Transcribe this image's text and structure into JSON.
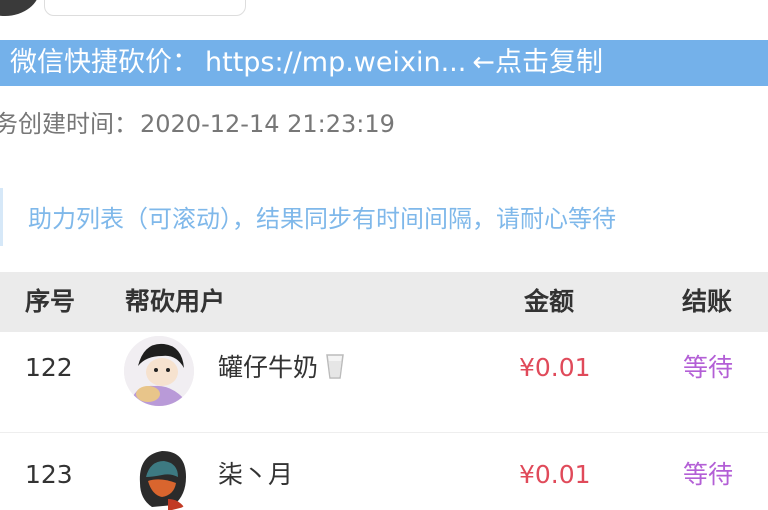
{
  "link_bar": {
    "label": "微信快捷砍价：",
    "url": "https://mp.weixin...",
    "action": "←点击复制"
  },
  "task": {
    "created_label": "务创建时间：",
    "created_value": "2020-12-14 21:23:19"
  },
  "notice": {
    "text": "助力列表（可滚动），结果同步有时间间隔，请耐心等待"
  },
  "table": {
    "headers": {
      "index": "序号",
      "user": "帮砍用户",
      "amount": "金额",
      "status": "结账"
    },
    "rows": [
      {
        "index": "122",
        "name": "罐仔牛奶",
        "amount": "¥0.01",
        "status": "等待",
        "name_icon": "cup-icon"
      },
      {
        "index": "123",
        "name": "柒丶月",
        "amount": "¥0.01",
        "status": "等待"
      }
    ]
  },
  "colors": {
    "link_bar_bg": "#74b1ea",
    "notice_text": "#7fb8ea",
    "amount": "#e04a5a",
    "status": "#b35fd6"
  }
}
